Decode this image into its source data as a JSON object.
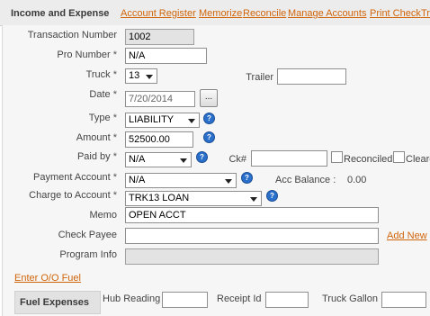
{
  "header": {
    "title": "Income and Expense",
    "links": [
      "Account Register",
      "Memorize",
      "Reconcile",
      "Manage Accounts",
      "Print Check",
      "Tr"
    ]
  },
  "form": {
    "transaction_number": {
      "label": "Transaction Number",
      "value": "1002"
    },
    "pro_number": {
      "label": "Pro Number",
      "value": "N/A"
    },
    "truck": {
      "label": "Truck",
      "value": "13"
    },
    "trailer": {
      "label": "Trailer",
      "value": ""
    },
    "date": {
      "label": "Date",
      "value": "7/20/2014",
      "button": "..."
    },
    "type": {
      "label": "Type",
      "value": "LIABILITY"
    },
    "amount": {
      "label": "Amount",
      "value": "52500.00"
    },
    "paid_by": {
      "label": "Paid by",
      "value": "N/A"
    },
    "ck": {
      "label": "Ck#",
      "value": ""
    },
    "reconciled": {
      "label": "Reconciled"
    },
    "cleared": {
      "label": "Cleare"
    },
    "payment_account": {
      "label": "Payment Account",
      "value": "N/A"
    },
    "acc_balance": {
      "label": "Acc Balance :",
      "value": "0.00"
    },
    "charge_to_account": {
      "label": "Charge to Account",
      "value": "TRK13 LOAN"
    },
    "memo": {
      "label": "Memo",
      "value": "OPEN ACCT"
    },
    "check_payee": {
      "label": "Check Payee",
      "value": "",
      "add_new": "Add New"
    },
    "program_info": {
      "label": "Program Info",
      "value": ""
    },
    "required_marker": "*",
    "help_glyph": "?"
  },
  "enter_oo_fuel": "Enter O/O Fuel",
  "fuel": {
    "title": "Fuel Expenses",
    "hub_reading": {
      "label": "Hub Reading",
      "value": ""
    },
    "receipt_id": {
      "label": "Receipt Id",
      "value": ""
    },
    "truck_gallon": {
      "label": "Truck Gallon",
      "value": ""
    }
  },
  "colors": {
    "link": "#d0650a",
    "help": "#2a6fc9",
    "panel": "#f6f6f6"
  }
}
